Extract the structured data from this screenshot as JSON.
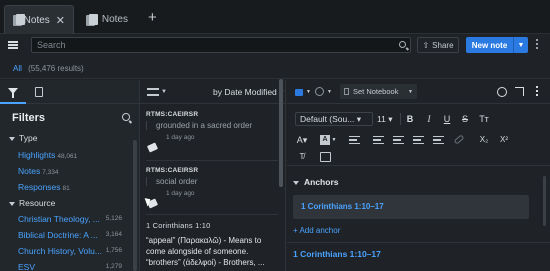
{
  "tabs": [
    {
      "label": "Notes",
      "close": "✕"
    },
    {
      "label": "Notes"
    }
  ],
  "newtab": "+",
  "toolbar": {
    "search_placeholder": "Search",
    "share_label": "Share",
    "new_note_label": "New note"
  },
  "results": {
    "all_label": "All",
    "count": "(55,476 results)"
  },
  "filters": {
    "title": "Filters",
    "sections": [
      {
        "label": "Type",
        "items": [
          {
            "label": "Highlights",
            "count": "48,061"
          },
          {
            "label": "Notes",
            "count": "7,334"
          },
          {
            "label": "Responses",
            "count": "81"
          }
        ]
      },
      {
        "label": "Resource",
        "items": [
          {
            "label": "Christian Theology, ...",
            "count": "5,126"
          },
          {
            "label": "Biblical Doctrine: A ...",
            "count": "3,164"
          },
          {
            "label": "Church History, Volu...",
            "count": "1,756"
          },
          {
            "label": "ESV",
            "count": "1,279"
          }
        ]
      }
    ]
  },
  "notes_list": {
    "sort_label": "by Date Modified",
    "items": [
      {
        "ref": "RTMS:CAEIRSR",
        "body": "grounded in a sacred order",
        "date": "1 day ago"
      },
      {
        "ref": "RTMS:CAEIRSR",
        "body": "social order",
        "date": "1 day ago"
      },
      {
        "ref": "1 Corinthians 1:10",
        "quote": "“appeal” (Παρακαλῶ) - Means to come alongside of someone. “brothers” (ἀδελφοί) - Brothers, ..."
      }
    ]
  },
  "editor": {
    "notebook_label": "Set Notebook",
    "font_label": "Default (Sou...",
    "font_size": "11",
    "anchors_title": "Anchors",
    "anchor_ref": "1 Corinthians 1:10–17",
    "add_anchor": "+ Add anchor",
    "body_ref": "1 Corinthians 1:10–17"
  },
  "colors": {
    "accent": "#2a7ae2",
    "link": "#4aa3ff",
    "bg": "#1f2327"
  }
}
